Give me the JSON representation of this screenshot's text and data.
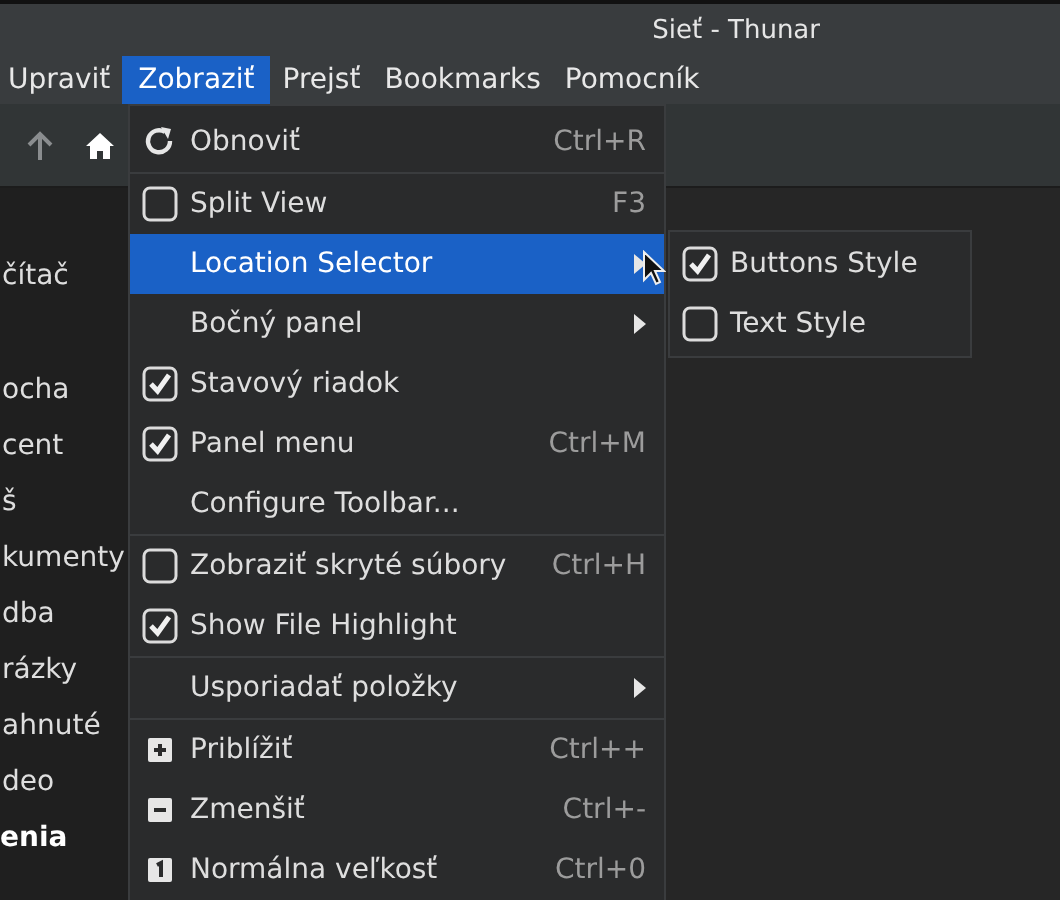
{
  "window": {
    "title": "Sieť - Thunar"
  },
  "menubar": [
    {
      "label": "Upraviť",
      "selected": false
    },
    {
      "label": "Zobraziť",
      "selected": true
    },
    {
      "label": "Prejsť",
      "selected": false
    },
    {
      "label": "Bookmarks",
      "selected": false
    },
    {
      "label": "Pomocník",
      "selected": false
    }
  ],
  "toolbar": {
    "up_disabled": true
  },
  "sidebar": {
    "sections": [
      {
        "items": [
          "čítač"
        ]
      },
      {
        "items": [
          "ocha",
          "cent",
          "š",
          "kumenty",
          "dba",
          "rázky",
          "ahnuté",
          "deo"
        ]
      },
      {
        "title": "enia"
      }
    ]
  },
  "menu": {
    "groups": [
      {
        "items": [
          {
            "kind": "reload",
            "label": "Obnoviť",
            "shortcut": "Ctrl+R",
            "selected": false,
            "submenu": false
          }
        ]
      },
      {
        "items": [
          {
            "kind": "check",
            "label": "Split View",
            "checked": false,
            "shortcut": "F3",
            "selected": false,
            "submenu": false
          },
          {
            "kind": "plain",
            "label": "Location Selector",
            "selected": true,
            "submenu": true
          },
          {
            "kind": "plain",
            "label": "Bočný panel",
            "selected": false,
            "submenu": true
          },
          {
            "kind": "check",
            "label": "Stavový riadok",
            "checked": true,
            "selected": false,
            "submenu": false
          },
          {
            "kind": "check",
            "label": "Panel menu",
            "checked": true,
            "shortcut": "Ctrl+M",
            "selected": false,
            "submenu": false
          },
          {
            "kind": "plain",
            "label": "Configure Toolbar...",
            "selected": false,
            "submenu": false
          }
        ]
      },
      {
        "items": [
          {
            "kind": "check",
            "label": "Zobraziť skryté súbory",
            "checked": false,
            "shortcut": "Ctrl+H",
            "selected": false,
            "submenu": false
          },
          {
            "kind": "check",
            "label": "Show File Highlight",
            "checked": true,
            "selected": false,
            "submenu": false
          }
        ]
      },
      {
        "items": [
          {
            "kind": "plain",
            "label": "Usporiadať položky",
            "selected": false,
            "submenu": true
          }
        ]
      },
      {
        "items": [
          {
            "kind": "zoomin",
            "label": "Priblížiť",
            "shortcut": "Ctrl++",
            "selected": false,
            "submenu": false
          },
          {
            "kind": "zoomout",
            "label": "Zmenšiť",
            "shortcut": "Ctrl+-",
            "selected": false,
            "submenu": false
          },
          {
            "kind": "zoomreset",
            "label": "Normálna veľkosť",
            "shortcut": "Ctrl+0",
            "selected": false,
            "submenu": false
          }
        ]
      }
    ]
  },
  "submenu": {
    "items": [
      {
        "label": "Buttons Style",
        "checked": true
      },
      {
        "label": "Text Style",
        "checked": false
      }
    ]
  }
}
